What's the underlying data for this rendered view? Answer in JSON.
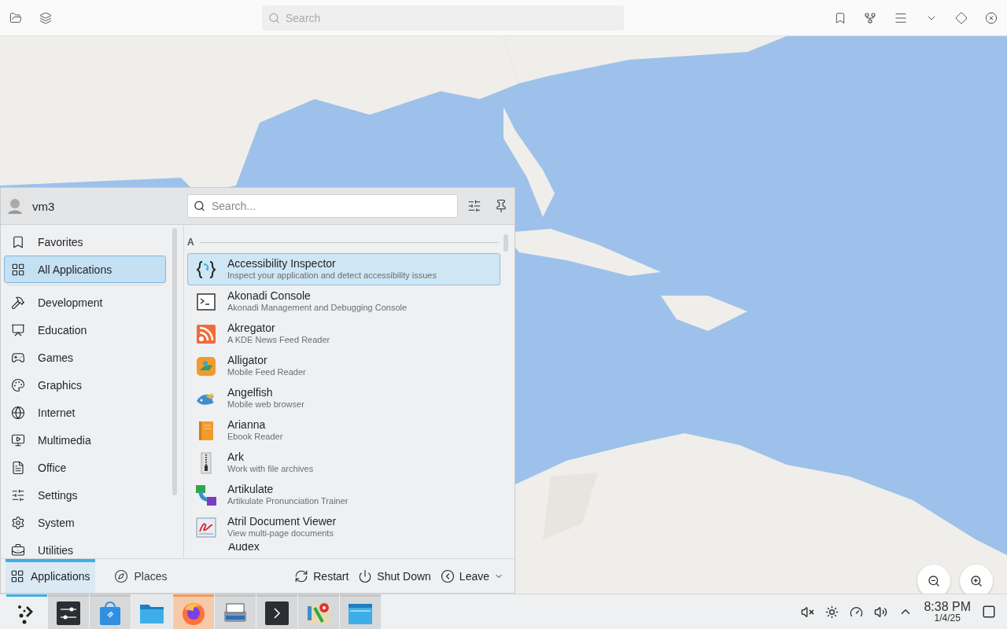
{
  "toolbar": {
    "search": {
      "placeholder": "Search"
    }
  },
  "launcher": {
    "user": "vm3",
    "search": {
      "placeholder": "Search..."
    },
    "categories": [
      {
        "label": "Favorites",
        "kind": "bookmark",
        "selected": false
      },
      {
        "label": "All Applications",
        "kind": "grid",
        "selected": true
      },
      {
        "label": "Development",
        "kind": "hammer",
        "selected": false
      },
      {
        "label": "Education",
        "kind": "board",
        "selected": false
      },
      {
        "label": "Games",
        "kind": "gamepad",
        "selected": false
      },
      {
        "label": "Graphics",
        "kind": "palette",
        "selected": false
      },
      {
        "label": "Internet",
        "kind": "globe",
        "selected": false
      },
      {
        "label": "Multimedia",
        "kind": "monitor",
        "selected": false
      },
      {
        "label": "Office",
        "kind": "document",
        "selected": false
      },
      {
        "label": "Settings",
        "kind": "sliders",
        "selected": false
      },
      {
        "label": "System",
        "kind": "gear",
        "selected": false
      },
      {
        "label": "Utilities",
        "kind": "toolbox",
        "selected": false
      }
    ],
    "section": "A",
    "apps": [
      {
        "name": "Accessibility Inspector",
        "description": "Inspect your application and detect accessibility issues",
        "kind": "braces",
        "selected": true
      },
      {
        "name": "Akonadi Console",
        "description": "Akonadi Management and Debugging Console",
        "kind": "terminal",
        "selected": false
      },
      {
        "name": "Akregator",
        "description": "A KDE News Feed Reader",
        "kind": "rss",
        "selected": false
      },
      {
        "name": "Alligator",
        "description": "Mobile Feed Reader",
        "kind": "alligator",
        "selected": false
      },
      {
        "name": "Angelfish",
        "description": "Mobile web browser",
        "kind": "fish",
        "selected": false
      },
      {
        "name": "Arianna",
        "description": "Ebook Reader",
        "kind": "book",
        "selected": false
      },
      {
        "name": "Ark",
        "description": "Work with file archives",
        "kind": "archive",
        "selected": false
      },
      {
        "name": "Artikulate",
        "description": "Artikulate Pronunciation Trainer",
        "kind": "bubbles",
        "selected": false
      },
      {
        "name": "Atril Document Viewer",
        "description": "View multi-page documents",
        "kind": "pdf",
        "selected": false
      }
    ],
    "partial_app": "Audex",
    "tabs": [
      {
        "label": "Applications",
        "kind": "grid",
        "selected": true
      },
      {
        "label": "Places",
        "kind": "compass",
        "selected": false
      }
    ],
    "power": [
      {
        "label": "Restart",
        "kind": "restart"
      },
      {
        "label": "Shut Down",
        "kind": "power"
      },
      {
        "label": "Leave",
        "kind": "leave"
      }
    ]
  },
  "taskbar": {
    "launcher": {
      "active": true
    },
    "tasks": [
      {
        "kind": "settings",
        "running": true,
        "attention": false
      },
      {
        "kind": "store",
        "running": true,
        "attention": false
      },
      {
        "kind": "folder",
        "running": false,
        "attention": false
      },
      {
        "kind": "firefox",
        "running": true,
        "attention": true
      },
      {
        "kind": "scanner",
        "running": true,
        "attention": false
      },
      {
        "kind": "terminal",
        "running": true,
        "attention": false
      },
      {
        "kind": "maps",
        "running": true,
        "attention": false
      },
      {
        "kind": "files",
        "running": true,
        "attention": false
      }
    ],
    "clock": {
      "time": "8:38 PM",
      "date": "1/4/25"
    }
  }
}
